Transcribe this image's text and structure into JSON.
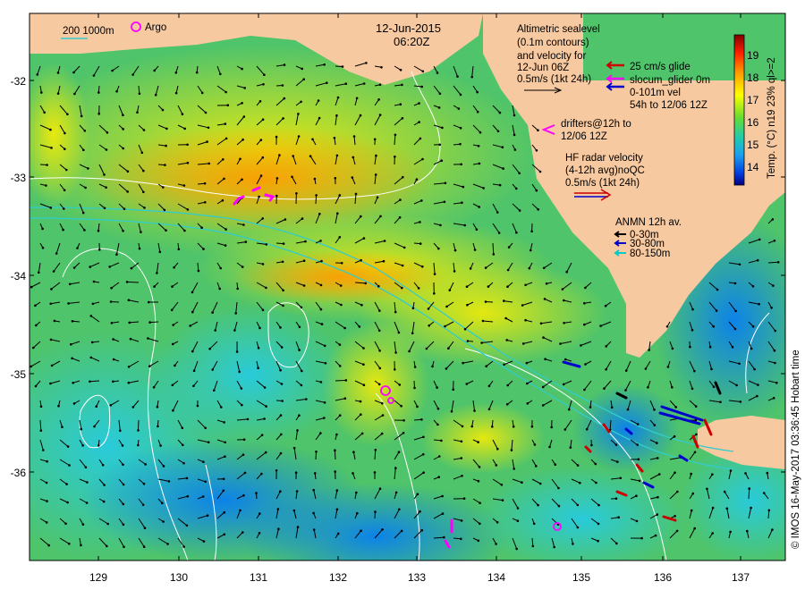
{
  "date": "12-Jun-2015",
  "time": "06:20Z",
  "scale_bar": {
    "depth_label": "200  1000m",
    "argo_label": "Argo"
  },
  "altimetry": {
    "lines": [
      "Altimetric sealevel",
      "(0.1m contours)",
      "and velocity for",
      "12-Jun 06Z",
      "0.5m/s (1kt 24h)"
    ]
  },
  "glider_legend": {
    "lines": [
      "25 cm/s glide",
      "slocum_glider 0m",
      "0-101m vel",
      "54h to 12/06 12Z"
    ],
    "colors": [
      "#cc0000",
      "#ff00ff",
      "#0000cc"
    ]
  },
  "drifters": {
    "lines": [
      "drifters@12h to",
      "12/06 12Z"
    ],
    "color": "#ff00ff"
  },
  "hf_radar": {
    "lines": [
      "HF radar velocity",
      "(4-12h avg)noQC",
      "0.5m/s (1kt 24h)"
    ]
  },
  "anmn": {
    "title": "ANMN 12h av.",
    "items": [
      {
        "label": "0-30m",
        "color": "#000000"
      },
      {
        "label": "30-80m",
        "color": "#0000cc"
      },
      {
        "label": "80-150m",
        "color": "#00cccc"
      }
    ]
  },
  "colorbar": {
    "ticks": [
      "19",
      "18",
      "17",
      "16",
      "15",
      "14"
    ],
    "label": "Temp. (°C) n19 23% ql>=2",
    "range": [
      13.3,
      19.8
    ]
  },
  "x_axis": {
    "labels": [
      "129",
      "130",
      "131",
      "132",
      "133",
      "134",
      "135",
      "136",
      "137"
    ]
  },
  "y_axis": {
    "labels": [
      "-32",
      "-33",
      "-34",
      "-35",
      "-36"
    ]
  },
  "credit": "© IMOS 16-May-2017 03:36:45 Hobart time",
  "colors": {
    "land": "#f7c9a0",
    "contour": "#ffffff",
    "shelf": "#33cccc"
  }
}
